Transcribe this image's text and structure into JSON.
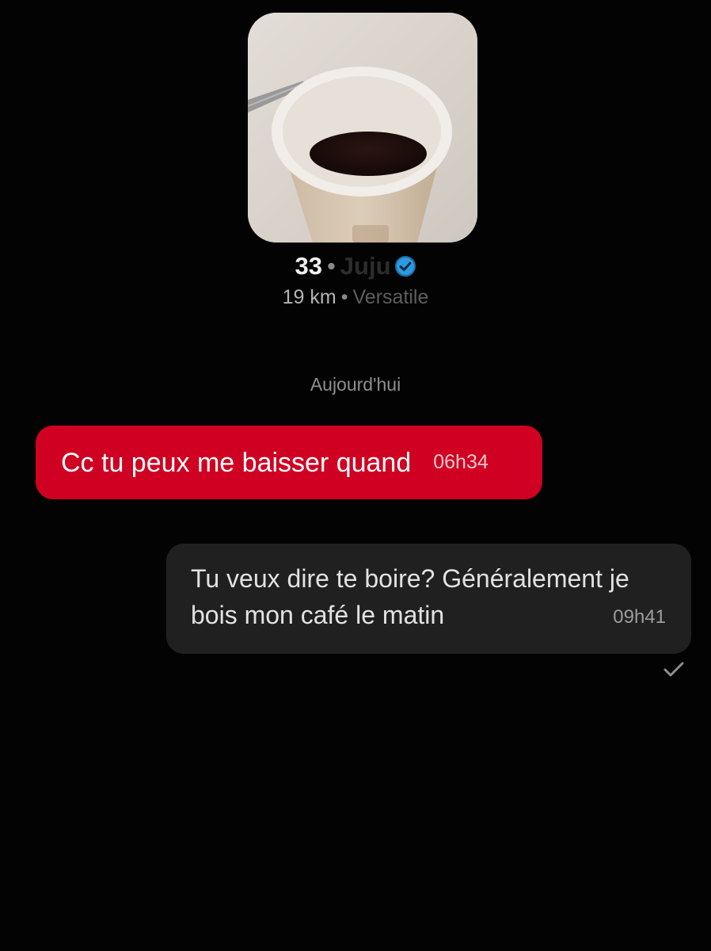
{
  "profile": {
    "photo_icon": "coffee-cup-photo",
    "age": "33",
    "separator": "•",
    "name": "Juju",
    "verified_icon": "verified-badge-icon",
    "distance": "19 km",
    "position": "Versatile"
  },
  "conversation": {
    "date_divider": "Aujourd'hui",
    "messages": [
      {
        "direction": "incoming",
        "text": "Cc tu peux me baisser quand",
        "time": "06h34"
      },
      {
        "direction": "outgoing",
        "text": "Tu veux dire te boire? Généralement je bois mon café le matin",
        "time": "09h41",
        "status_icon": "check-icon"
      }
    ]
  },
  "colors": {
    "background": "#030303",
    "incoming_bubble": "#cf0021",
    "outgoing_bubble": "#202020",
    "verified_badge": "#2b9be0"
  }
}
